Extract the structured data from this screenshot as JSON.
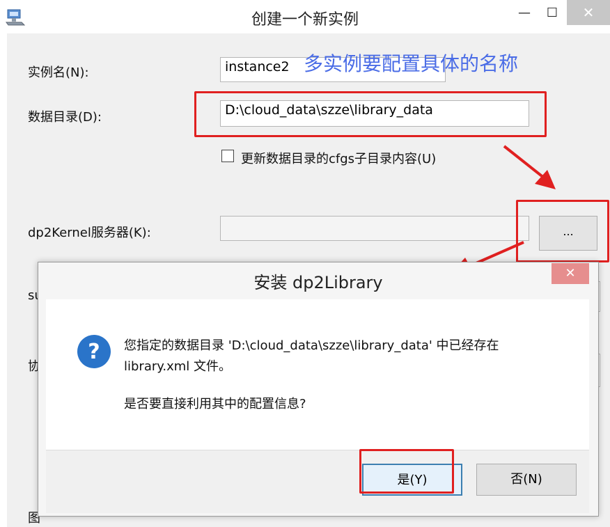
{
  "window": {
    "title": "创建一个新实例",
    "minimize_glyph": "—",
    "maximize_glyph": "☐",
    "close_glyph": "✕",
    "app_icon": "app-computer-icon"
  },
  "form": {
    "instance_name_label": "实例名(N):",
    "instance_name_value": "instance2",
    "data_dir_label": "数据目录(D):",
    "data_dir_value": "D:\\cloud_data\\szze\\library_data",
    "update_cfgs_label": "更新数据目录的cfgs子目录内容(U)",
    "kernel_label": "dp2Kernel服务器(K):",
    "kernel_value": "",
    "browse_label": "...",
    "partial_label_1": "su",
    "partial_label_2": "协",
    "partial_label_3": "图"
  },
  "annotation": {
    "text": "多实例要配置具体的名称",
    "color": "#4a6ce6",
    "highlight_color": "#e02020"
  },
  "dialog": {
    "title": "安装 dp2Library",
    "close_glyph": "✕",
    "icon": "question-icon",
    "message_line1": "您指定的数据目录 'D:\\cloud_data\\szze\\library_data' 中已经存在",
    "message_line2": "library.xml 文件。",
    "message_line3": "是否要直接利用其中的配置信息?",
    "yes_label": "是(Y)",
    "no_label": "否(N)"
  }
}
